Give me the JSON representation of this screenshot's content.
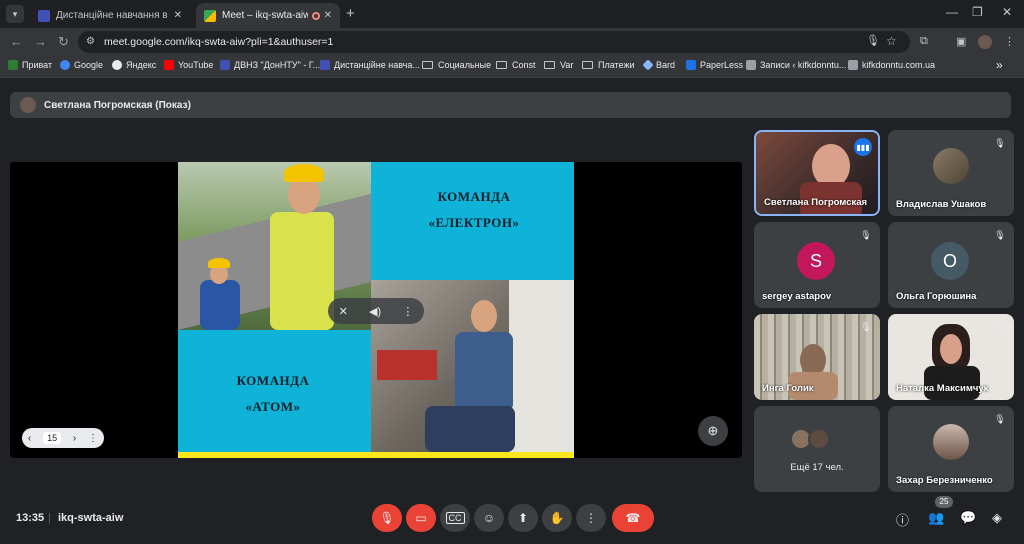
{
  "browser": {
    "tabs": [
      {
        "title": "Дистанційне навчання в ВСП",
        "favicon_color": "#3f51b5"
      },
      {
        "title": "Meet – ikq-swta-aiw",
        "favicon_color": "#34a853",
        "recording_icon": "record-icon"
      }
    ],
    "new_tab_label": "+",
    "url": "meet.google.com/ikq-swta-aiw?pli=1&authuser=1",
    "bookmarks": [
      {
        "label": "Приват",
        "icon": "privat-icon",
        "color": "#2f7d32"
      },
      {
        "label": "Google",
        "icon": "google-icon",
        "color": "#4285f4"
      },
      {
        "label": "Яндекс",
        "icon": "yandex-icon",
        "color": "#e8eaed"
      },
      {
        "label": "YouTube",
        "icon": "youtube-icon",
        "color": "#ff0000"
      },
      {
        "label": "ДВНЗ \"ДонНТУ\" - Г...",
        "icon": "donntu-icon",
        "color": "#3f51b5"
      },
      {
        "label": "Дистанційне навча...",
        "icon": "classroom-icon",
        "color": "#3f51b5"
      },
      {
        "label": "Социальные",
        "icon": "folder-icon"
      },
      {
        "label": "Const",
        "icon": "folder-icon"
      },
      {
        "label": "Var",
        "icon": "folder-icon"
      },
      {
        "label": "Платежи",
        "icon": "folder-icon"
      },
      {
        "label": "Bard",
        "icon": "bard-icon",
        "color": "#8ab4f8"
      },
      {
        "label": "PaperLess",
        "icon": "paperless-icon",
        "color": "#1a73e8"
      },
      {
        "label": "Записи ‹ kifkdonntu...",
        "icon": "wordpress-icon",
        "color": "#9aa0a6"
      },
      {
        "label": "kifkdonntu.com.ua",
        "icon": "site-icon",
        "color": "#9aa0a6"
      }
    ],
    "more_bookmarks": "»"
  },
  "meeting": {
    "presenter": "Светлана Погромская (Показ)",
    "slide": {
      "team1_line1": "КОМАНДА",
      "team1_line2": "«ЕЛЕКТРОН»",
      "team2_line1": "КОМАНДА",
      "team2_line2": "«АТОМ»",
      "page": "15"
    },
    "participants": [
      {
        "name": "Светлана Погромская",
        "type": "video",
        "speaking": true
      },
      {
        "name": "Владислав Ушаков",
        "type": "photo",
        "muted": true
      },
      {
        "name": "sergey astapov",
        "type": "letter",
        "letter": "S",
        "color": "#c2185b",
        "muted": true
      },
      {
        "name": "Ольга Горюшина",
        "type": "letter",
        "letter": "О",
        "color": "#455a64",
        "muted": true
      },
      {
        "name": "Инга Голик",
        "type": "video",
        "muted": true
      },
      {
        "name": "Наталка Максимчук",
        "type": "video",
        "muted": true
      },
      {
        "name": "Захар Березниченко",
        "type": "photo",
        "muted": true
      }
    ],
    "more_participants": "Ещё 17 чел.",
    "time": "13:35",
    "code": "ikq-swta-aiw",
    "people_count": "25"
  }
}
